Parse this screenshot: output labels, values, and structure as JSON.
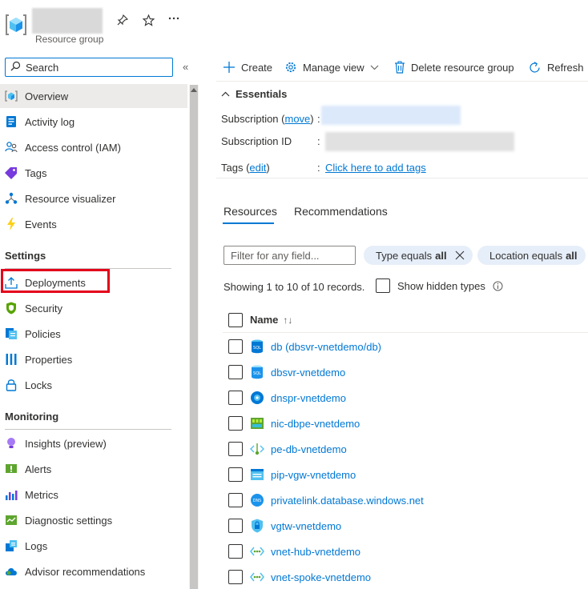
{
  "header": {
    "resource_type": "Resource group",
    "pin_icon": "pin-icon",
    "favorite_icon": "star-icon",
    "more_icon": "more-icon"
  },
  "sidebar": {
    "search_placeholder": "Search",
    "collapse_glyph": "«",
    "items_top": [
      {
        "label": "Overview",
        "icon": "resource-group-icon",
        "active": true
      },
      {
        "label": "Activity log",
        "icon": "activity-log-icon"
      },
      {
        "label": "Access control (IAM)",
        "icon": "people-icon"
      },
      {
        "label": "Tags",
        "icon": "tag-icon"
      },
      {
        "label": "Resource visualizer",
        "icon": "visualizer-icon"
      },
      {
        "label": "Events",
        "icon": "lightning-icon"
      }
    ],
    "section_settings": "Settings",
    "items_settings": [
      {
        "label": "Deployments",
        "icon": "upload-icon"
      },
      {
        "label": "Security",
        "icon": "shield-icon"
      },
      {
        "label": "Policies",
        "icon": "policy-icon"
      },
      {
        "label": "Properties",
        "icon": "properties-icon"
      },
      {
        "label": "Locks",
        "icon": "lock-icon"
      }
    ],
    "section_monitoring": "Monitoring",
    "items_monitoring": [
      {
        "label": "Insights (preview)",
        "icon": "bulb-icon"
      },
      {
        "label": "Alerts",
        "icon": "alert-icon"
      },
      {
        "label": "Metrics",
        "icon": "metrics-icon"
      },
      {
        "label": "Diagnostic settings",
        "icon": "diagnostic-icon"
      },
      {
        "label": "Logs",
        "icon": "logs-icon"
      },
      {
        "label": "Advisor recommendations",
        "icon": "cloud-icon"
      }
    ]
  },
  "toolbar": {
    "create": "Create",
    "manage_view": "Manage view",
    "delete": "Delete resource group",
    "refresh": "Refresh"
  },
  "essentials": {
    "title": "Essentials",
    "subscription_label": "Subscription (",
    "subscription_link": "move",
    "subscription_close": ")",
    "subscription_id_label": "Subscription ID",
    "tags_label": "Tags (",
    "tags_link": "edit",
    "tags_close": ")",
    "colon": ":",
    "add_tags_link": "Click here to add tags"
  },
  "tabs": {
    "resources": "Resources",
    "recommendations": "Recommendations"
  },
  "filters": {
    "placeholder": "Filter for any field...",
    "type_prefix": "Type equals",
    "type_value": "all",
    "location_prefix": "Location equals",
    "location_value": "all"
  },
  "records_text": "Showing 1 to 10 of 10 records.",
  "show_hidden": "Show hidden types",
  "grid": {
    "column_name": "Name",
    "sort_glyph": "↑↓",
    "rows": [
      {
        "name": "db (dbsvr-vnetdemo/db)",
        "icon": "sql-database-icon"
      },
      {
        "name": "dbsvr-vnetdemo",
        "icon": "sql-server-icon"
      },
      {
        "name": "dnspr-vnetdemo",
        "icon": "dns-resolver-icon"
      },
      {
        "name": "nic-dbpe-vnetdemo",
        "icon": "network-interface-icon"
      },
      {
        "name": "pe-db-vnetdemo",
        "icon": "private-endpoint-icon"
      },
      {
        "name": "pip-vgw-vnetdemo",
        "icon": "public-ip-icon"
      },
      {
        "name": "privatelink.database.windows.net",
        "icon": "private-dns-zone-icon"
      },
      {
        "name": "vgtw-vnetdemo",
        "icon": "vpn-gateway-icon"
      },
      {
        "name": "vnet-hub-vnetdemo",
        "icon": "virtual-network-icon"
      },
      {
        "name": "vnet-spoke-vnetdemo",
        "icon": "virtual-network-icon"
      }
    ]
  }
}
